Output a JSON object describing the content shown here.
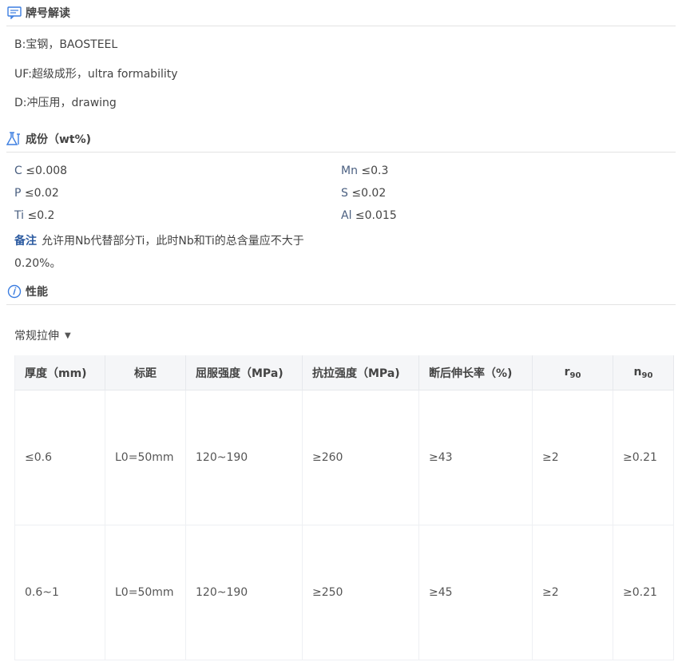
{
  "sections": {
    "grade": {
      "title": "牌号解读",
      "icon": "comment-icon"
    },
    "composition": {
      "title": "成份（wt%)",
      "icon": "flask-icon"
    },
    "properties": {
      "title": "性能",
      "icon": "info-circle-icon"
    }
  },
  "grade_lines": [
    "B:宝钢，BAOSTEEL",
    "UF:超级成形，ultra formability",
    "D:冲压用，drawing"
  ],
  "composition": {
    "c": {
      "el": "C",
      "val": "≤0.008"
    },
    "mn": {
      "el": "Mn",
      "val": "≤0.3"
    },
    "p": {
      "el": "P",
      "val": "≤0.02"
    },
    "s": {
      "el": "S",
      "val": "≤0.02"
    },
    "ti": {
      "el": "Ti",
      "val": "≤0.2"
    },
    "al": {
      "el": "Al",
      "val": "≤0.015"
    },
    "note_tag": "备注",
    "note_text": "允许用Nb代替部分Ti，此时Nb和Ti的总含量应不大于0.20%。"
  },
  "dropdown": {
    "label": "常规拉伸"
  },
  "table": {
    "headers": {
      "thickness": "厚度（mm)",
      "gauge": "标距",
      "yield": "屈服强度（MPa)",
      "tensile": "抗拉强度（MPa)",
      "elong": "断后伸长率（%)",
      "r_main": "r",
      "r_sub": "90",
      "n_main": "n",
      "n_sub": "90"
    },
    "rows": [
      {
        "thickness": "≤0.6",
        "gauge": "L0=50mm",
        "yield": "120~190",
        "tensile": "≥260",
        "elong": "≥43",
        "r": "≥2",
        "n": "≥0.21"
      },
      {
        "thickness": "0.6~1",
        "gauge": "L0=50mm",
        "yield": "120~190",
        "tensile": "≥250",
        "elong": "≥45",
        "r": "≥2",
        "n": "≥0.21"
      }
    ]
  }
}
